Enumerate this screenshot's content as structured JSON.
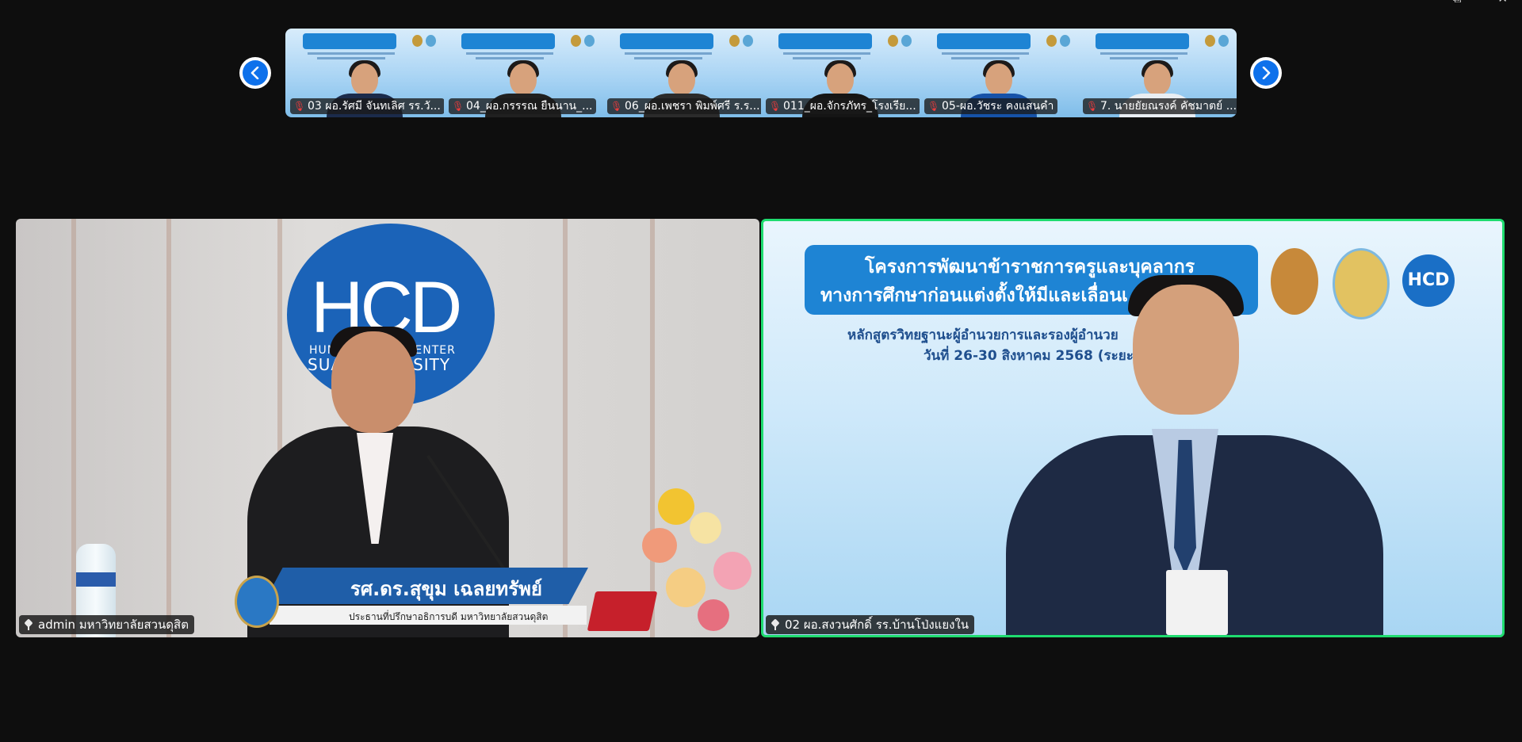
{
  "window": {
    "controls": [
      {
        "name": "popout-icon",
        "glyph": "⧉"
      },
      {
        "name": "close-icon",
        "glyph": "✕"
      }
    ]
  },
  "strip": {
    "prev_icon": "chevron-left-icon",
    "next_icon": "chevron-right-icon",
    "participants": [
      {
        "label": "03 ผอ.รัศมี จันทเลิศ รร.วั...",
        "muted": true
      },
      {
        "label": "04_ผอ.กรรรณ ยืนนาน_...",
        "muted": true
      },
      {
        "label": "06_ผอ.เพชรา พิมพ์ศรี ร.ร...",
        "muted": true
      },
      {
        "label": "011_ผอ.จักรภัทร_โรงเรีย...",
        "muted": true
      },
      {
        "label": "05-ผอ.วัชระ คงแสนคำ",
        "muted": true
      },
      {
        "label": "7. นายยัยณรงค์ คัชมาตย์ ...",
        "muted": true
      }
    ]
  },
  "videos": {
    "left": {
      "label": "admin มหาวิทยาลัยสวนดุสิต",
      "hcd_text": "HCD",
      "hcd_sub1": "HUMAN   EMENT CENTER",
      "hcd_sub2": "SUA      UNIVERSITY",
      "speaker_name": "รศ.ดร.สุขุม เฉลยทรัพย์",
      "speaker_role": "ประธานที่ปรึกษาอธิการบดี มหาวิทยาลัยสวนดุสิต"
    },
    "right": {
      "label": "02 ผอ.สงวนศักดิ์ รร.บ้านโป่งแยงใน",
      "banner_line1": "โครงการพัฒนาข้าราชการครูและบุคลากร",
      "banner_line2": "ทางการศึกษาก่อนแต่งตั้งให้มีและเลื่อนเ       ะ",
      "sub_line1": "หลักสูตรวิทยฐานะผู้อำนวยการและรองผู้อำนวย",
      "sub_line2": "วันที่ 26-30 สิงหาคม 2568 (ระยะที่",
      "logo_text": "HCD",
      "active_speaker_color": "#1fdc6f"
    }
  }
}
